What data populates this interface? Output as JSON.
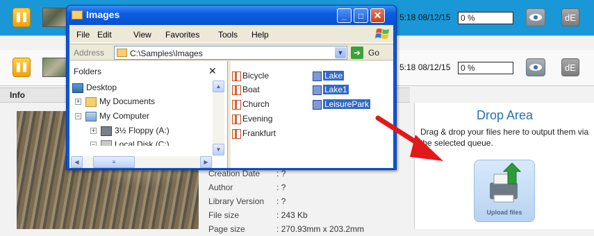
{
  "queue_rows": [
    {
      "time": "5:18 08/12/15",
      "progress": "0 %",
      "de_label": "dE"
    },
    {
      "time": "5:18 08/12/15",
      "progress": "0 %",
      "de_label": "dE"
    }
  ],
  "info": {
    "header": "Info",
    "meta": [
      {
        "key": "Creation Date",
        "value": ": ?"
      },
      {
        "key": "Author",
        "value": ": ?"
      },
      {
        "key": "Library Version",
        "value": ": ?"
      },
      {
        "key": "File size",
        "value": ": 243 Kb"
      },
      {
        "key": "Page size",
        "value": ": 270.93mm x 203.2mm"
      }
    ]
  },
  "drop_area": {
    "title": "Drop Area",
    "description": "Drag & drop your files here to output them via the selected queue.",
    "upload_label": "Upload files"
  },
  "explorer": {
    "title": "Images",
    "menu": [
      "File",
      "Edit",
      "View",
      "Favorites",
      "Tools",
      "Help"
    ],
    "address_label": "Address",
    "address_value": "C:\\Samples\\Images",
    "go_label": "Go",
    "folders_header": "Folders",
    "tree": [
      {
        "label": "Desktop",
        "level": 0,
        "expander": ""
      },
      {
        "label": "My Documents",
        "level": 1,
        "expander": "+"
      },
      {
        "label": "My Computer",
        "level": 1,
        "expander": "−"
      },
      {
        "label": "3½ Floppy (A:)",
        "level": 2,
        "expander": "+"
      },
      {
        "label": "Local Disk (C:)",
        "level": 2,
        "expander": "−"
      }
    ],
    "files_col1": [
      "Bicycle",
      "Boat",
      "Church",
      "Evening",
      "Frankfurt"
    ],
    "files_col2": [
      "Lake",
      "Lake1",
      "LeisurePark"
    ]
  },
  "colors": {
    "selected_row": "#1a97d6",
    "xp_title": "#0a5ee4",
    "selection": "#316ac5",
    "drop_title": "#2a6fb0",
    "arrow": "#e01a1a"
  }
}
